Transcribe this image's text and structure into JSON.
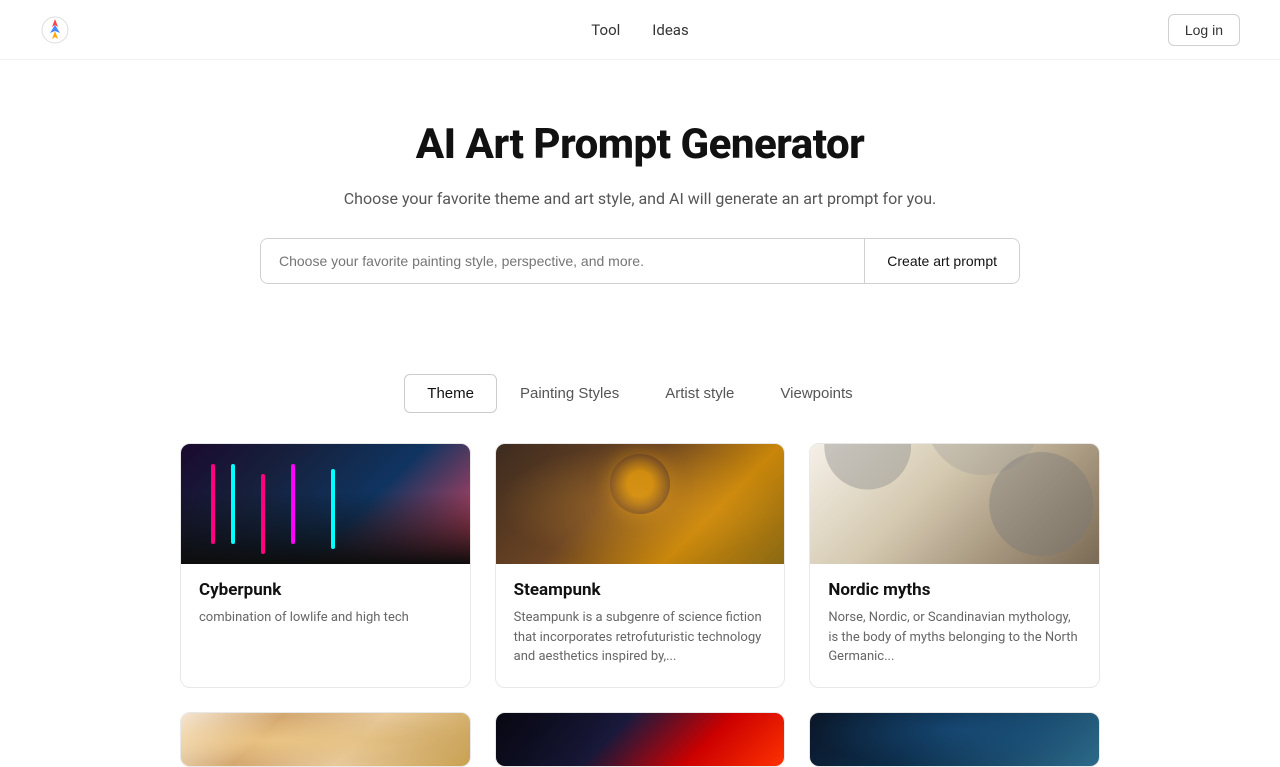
{
  "header": {
    "logo_alt": "AI Art Prompt Generator Logo",
    "nav": {
      "tool_label": "Tool",
      "ideas_label": "Ideas"
    },
    "login_label": "Log in"
  },
  "hero": {
    "title": "AI Art Prompt Generator",
    "subtitle": "Choose your favorite theme and art style, and AI will generate an art prompt for you.",
    "search_placeholder": "Choose your favorite painting style, perspective, and more.",
    "create_button_label": "Create art prompt"
  },
  "tabs": [
    {
      "id": "theme",
      "label": "Theme",
      "active": true
    },
    {
      "id": "painting-styles",
      "label": "Painting Styles",
      "active": false
    },
    {
      "id": "artist-style",
      "label": "Artist style",
      "active": false
    },
    {
      "id": "viewpoints",
      "label": "Viewpoints",
      "active": false
    }
  ],
  "cards": [
    {
      "id": "cyberpunk",
      "title": "Cyberpunk",
      "description": "combination of lowlife and high tech",
      "image_type": "cyberpunk"
    },
    {
      "id": "steampunk",
      "title": "Steampunk",
      "description": "Steampunk is a subgenre of science fiction that incorporates retrofuturistic technology and aesthetics inspired by,...",
      "image_type": "steampunk"
    },
    {
      "id": "nordic-myths",
      "title": "Nordic myths",
      "description": "Norse, Nordic, or Scandinavian mythology, is the body of myths belonging to the North Germanic...",
      "image_type": "nordic"
    }
  ],
  "bottom_cards": [
    {
      "id": "renaissance",
      "image_type": "renaissance"
    },
    {
      "id": "scifi",
      "image_type": "scifi"
    },
    {
      "id": "underwater",
      "image_type": "underwater"
    }
  ]
}
